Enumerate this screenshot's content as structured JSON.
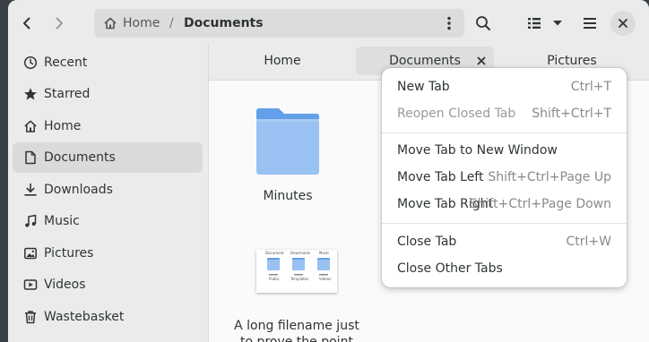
{
  "colors": {
    "folder_top": "#62a0ea",
    "folder_body": "#99c1f1",
    "accent": "#3584e4"
  },
  "header": {
    "back_icon": "chevron-left-icon",
    "forward_icon": "chevron-right-icon",
    "path": {
      "home": "Home",
      "separator": "/",
      "current": "Documents"
    },
    "search_icon": "search-icon",
    "view_icon": "list-view-icon",
    "menu_icon": "hamburger-icon",
    "close_icon": "close-icon"
  },
  "sidebar": {
    "items": [
      {
        "label": "Recent",
        "icon": "clock-icon"
      },
      {
        "label": "Starred",
        "icon": "star-icon"
      },
      {
        "label": "Home",
        "icon": "home-icon"
      },
      {
        "label": "Documents",
        "icon": "document-icon",
        "active": true
      },
      {
        "label": "Downloads",
        "icon": "download-icon"
      },
      {
        "label": "Music",
        "icon": "music-icon"
      },
      {
        "label": "Pictures",
        "icon": "picture-icon"
      },
      {
        "label": "Videos",
        "icon": "video-icon"
      },
      {
        "label": "Wastebasket",
        "icon": "trash-icon"
      }
    ]
  },
  "tabs": [
    {
      "label": "Home"
    },
    {
      "label": "Documents",
      "active": true
    },
    {
      "label": "Pictures"
    }
  ],
  "files": [
    {
      "name": "Minutes",
      "type": "folder"
    },
    {
      "name": "A long filename just to prove the point",
      "type": "thumbnail",
      "thumb_labels": [
        "Document",
        "Downloads",
        "Music",
        "Public",
        "Templates",
        "Videos"
      ]
    }
  ],
  "context_menu": {
    "items": [
      {
        "label": "New Tab",
        "shortcut": "Ctrl+T"
      },
      {
        "label": "Reopen Closed Tab",
        "shortcut": "Shift+Ctrl+T",
        "disabled": true
      },
      {
        "label": "Move Tab to New Window",
        "shortcut": ""
      },
      {
        "label": "Move Tab Left",
        "shortcut": "Shift+Ctrl+Page Up"
      },
      {
        "label": "Move Tab Right",
        "shortcut": "Shift+Ctrl+Page Down"
      },
      {
        "label": "Close Tab",
        "shortcut": "Ctrl+W"
      },
      {
        "label": "Close Other Tabs",
        "shortcut": ""
      }
    ]
  }
}
